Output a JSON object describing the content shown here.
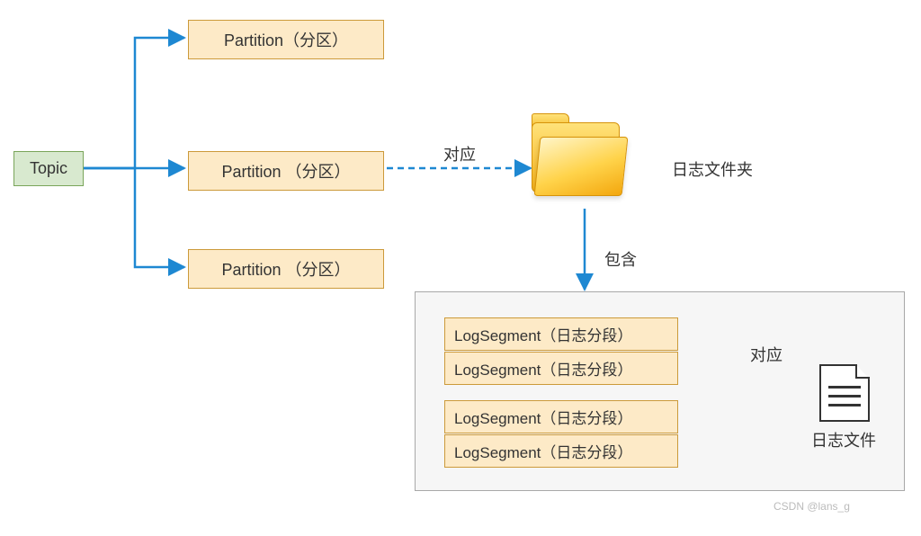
{
  "topic": {
    "label": "Topic"
  },
  "partitions": [
    {
      "label": "Partition（分区）"
    },
    {
      "label": "Partition （分区）"
    },
    {
      "label": "Partition （分区）"
    }
  ],
  "arrows": {
    "duiying": "对应",
    "baohan": "包含",
    "duiying2": "对应"
  },
  "folder": {
    "label": "日志文件夹"
  },
  "segments": [
    {
      "label": "LogSegment（日志分段）"
    },
    {
      "label": "LogSegment（日志分段）"
    },
    {
      "label": "LogSegment（日志分段）"
    },
    {
      "label": "LogSegment（日志分段）"
    }
  ],
  "file": {
    "label": "日志文件"
  },
  "watermark": "CSDN @lans_g"
}
